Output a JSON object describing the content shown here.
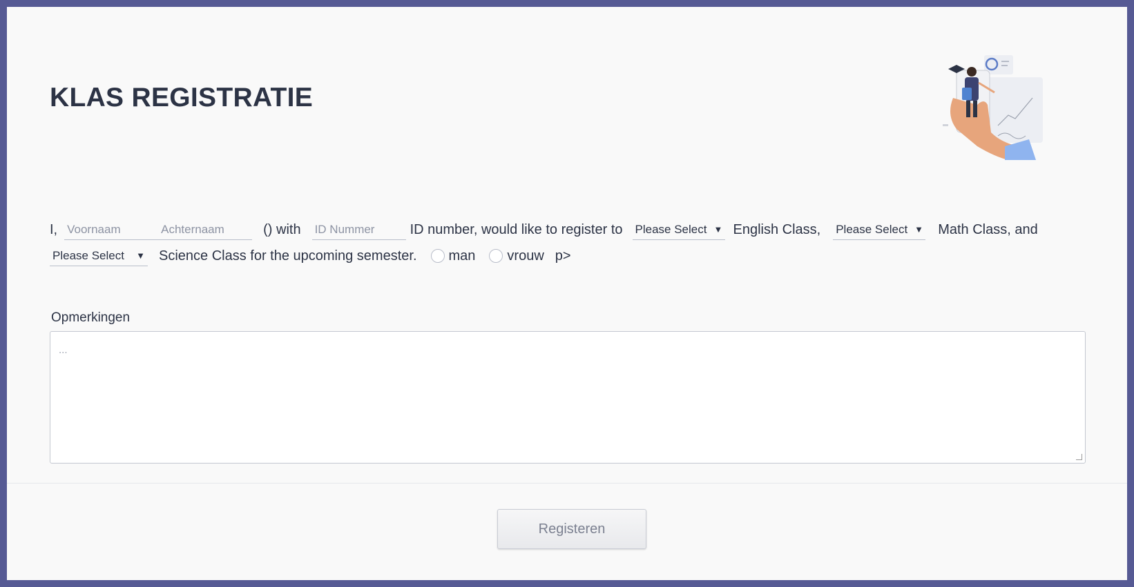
{
  "form": {
    "title": "KLAS REGISTRATIE",
    "sentence": {
      "prefix": "I,",
      "first_name_placeholder": "Voornaam",
      "last_name_placeholder": "Achternaam",
      "with_text": "() with",
      "id_placeholder": "ID Nummer",
      "register_text": "ID number, would like to register to",
      "english_select": "Please Select",
      "english_text": "English Class,",
      "math_select": "Please Select",
      "math_text": "Math Class, and",
      "science_select": "Please Select",
      "science_text": "Science Class for the upcoming semester.",
      "radio_man": "man",
      "radio_vrouw": "vrouw",
      "trailing_text": "p>"
    },
    "remarks_label": "Opmerkingen",
    "remarks_placeholder": "...",
    "submit_label": "Registeren"
  },
  "colors": {
    "frame": "#565a94",
    "background": "#f9f9f9",
    "text": "#2c3345"
  },
  "icons": {
    "caret": "caret-down-icon",
    "illustration": "student-on-phone-illustration"
  }
}
